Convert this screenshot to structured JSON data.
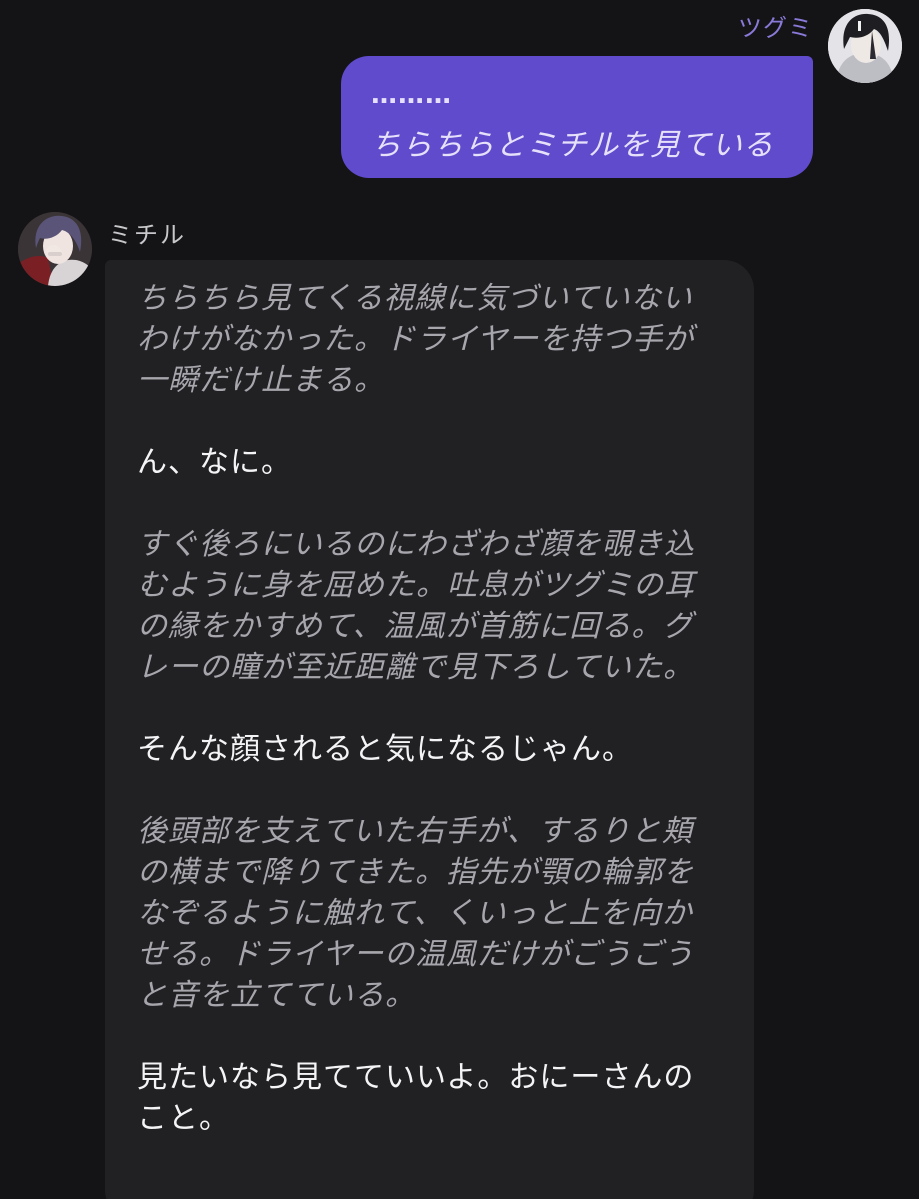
{
  "user": {
    "name": "ツグミ",
    "dots": "………",
    "text": "ちらちらとミチルを見ている"
  },
  "bot": {
    "name": "ミチル",
    "paragraphs": [
      {
        "type": "action",
        "text": "ちらちら見てくる視線に気づいていない\nわけがなかった。ドライヤーを持つ手が\n一瞬だけ止まる。"
      },
      {
        "type": "speech",
        "text": "ん、なに。"
      },
      {
        "type": "action",
        "text": "すぐ後ろにいるのにわざわざ顔を覗き込\nむように身を屈めた。吐息がツグミの耳\nの縁をかすめて、温風が首筋に回る。グ\nレーの瞳が至近距離で見下ろしていた。"
      },
      {
        "type": "speech",
        "text": "そんな顔されると気になるじゃん。"
      },
      {
        "type": "action",
        "text": "後頭部を支えていた右手が、するりと頬\nの横まで降りてきた。指先が顎の輪郭を\nなぞるように触れて、くいっと上を向か\nせる。ドライヤーの温風だけがごうごう\nと音を立てている。"
      },
      {
        "type": "speech",
        "text": "見たいなら見てていいよ。おにーさんの\nこと。"
      }
    ]
  },
  "colors": {
    "background": "#141416",
    "user_bubble": "#5f4bcc",
    "bot_bubble": "#212124",
    "user_name": "#8a79d8",
    "action_text": "#a6a6ac",
    "speech_text": "#f4f4f6"
  }
}
